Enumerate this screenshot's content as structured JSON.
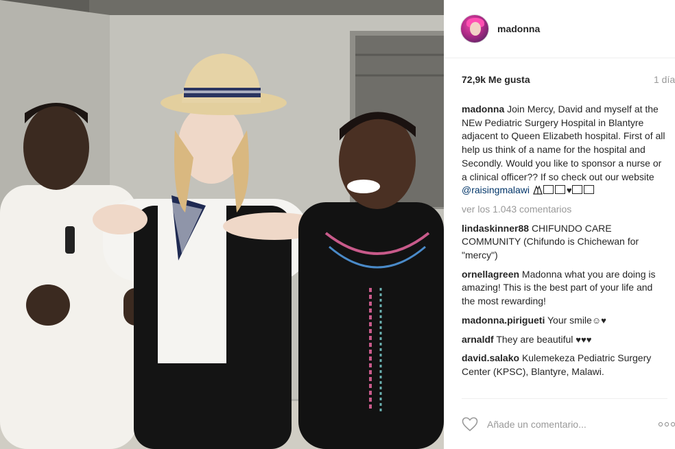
{
  "post": {
    "username": "madonna",
    "likes": "72,9k Me gusta",
    "time": "1 día"
  },
  "caption": {
    "user": "madonna",
    "text": "Join Mercy, David and myself at the NEw Pediatric Surgery Hospital in Blantyre adjacent to Queen Elizabeth hospital. First of all help us think of a name for the hospital and Secondly. Would you like to sponsor a nurse or a clinical officer?? If so check out our website",
    "mention": "@raisingmalawi"
  },
  "view_comments": "ver los 1.043 comentarios",
  "comments": [
    {
      "user": "lindaskinner88",
      "text": "CHIFUNDO CARE COMMUNITY (Chifundo is Chichewan for \"mercy\")"
    },
    {
      "user": "ornellagreen",
      "text": "Madonna what you are doing is amazing! This is the best part of your life and the most rewarding!"
    },
    {
      "user": "madonna.pirigueti",
      "text": "Your smile"
    },
    {
      "user": "arnaldf",
      "text": "They are beautiful"
    },
    {
      "user": "david.salako",
      "text": "Kulemekeza Pediatric Surgery Center (KPSC), Blantyre, Malawi."
    }
  ],
  "add_comment": {
    "placeholder": "Añade un comentario..."
  },
  "icons": {
    "avatar": "profile-avatar",
    "like": "heart-outline-icon",
    "options": "more-options-icon"
  },
  "colors": {
    "text": "#262626",
    "muted": "#999999",
    "link": "#003569",
    "border": "#efefef"
  }
}
